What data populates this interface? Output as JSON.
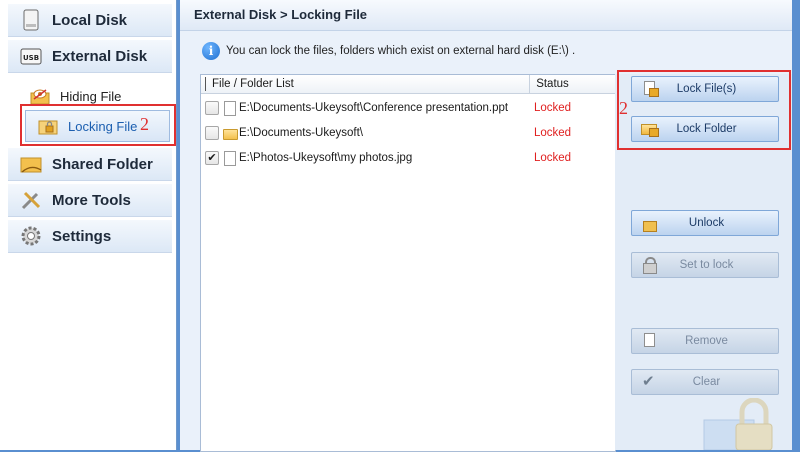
{
  "sidebar": {
    "items": [
      {
        "label": "Local Disk",
        "icon": "local-disk-icon"
      },
      {
        "label": "External Disk",
        "icon": "usb-drive-icon",
        "icon_text": "USB"
      },
      {
        "label": "Shared Folder",
        "icon": "shared-folder-icon"
      },
      {
        "label": "More Tools",
        "icon": "tools-icon"
      },
      {
        "label": "Settings",
        "icon": "gear-icon"
      }
    ],
    "sub_items": [
      {
        "label": "Hiding File",
        "icon": "hide-file-icon"
      },
      {
        "label": "Locking File",
        "icon": "lock-file-icon",
        "active": true
      }
    ],
    "annotation_number": "2"
  },
  "main": {
    "breadcrumb": "External Disk > Locking File",
    "info_text": "You can lock the files, folders which exist on external hard disk (E:\\) .",
    "info_icon_glyph": "i",
    "columns": {
      "file": "File / Folder List",
      "status": "Status"
    },
    "rows": [
      {
        "path": "E:\\Documents-Ukeysoft\\Conference presentation.ppt",
        "status": "Locked",
        "checked": false,
        "type": "file"
      },
      {
        "path": "E:\\Documents-Ukeysoft\\",
        "status": "Locked",
        "checked": false,
        "type": "folder"
      },
      {
        "path": "E:\\Photos-Ukeysoft\\my photos.jpg",
        "status": "Locked",
        "checked": true,
        "type": "file"
      }
    ],
    "check_glyph": "✔"
  },
  "buttons": {
    "lock_files": "Lock File(s)",
    "lock_folder": "Lock Folder",
    "unlock": "Unlock",
    "set_to_lock": "Set to lock",
    "remove": "Remove",
    "clear": "Clear",
    "annotation_number": "2"
  },
  "colors": {
    "accent": "#1c5fb0",
    "locked_status": "#e02020",
    "annotation": "#e03030"
  }
}
